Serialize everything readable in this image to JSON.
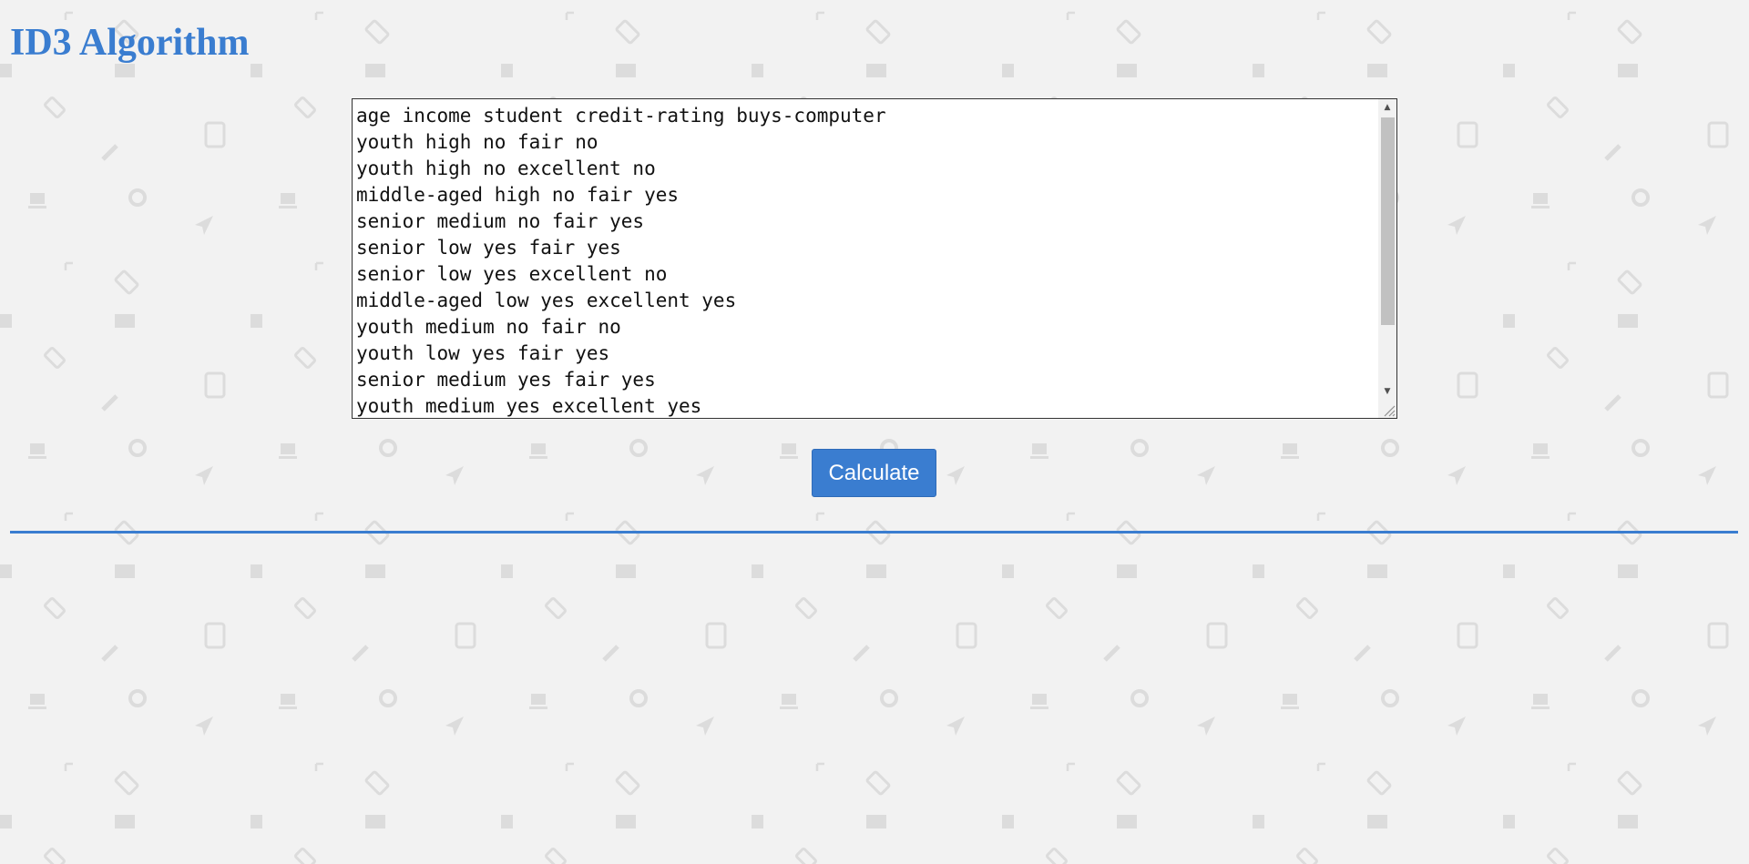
{
  "page": {
    "title": "ID3 Algorithm"
  },
  "dataset": {
    "text": "age income student credit-rating buys-computer\nyouth high no fair no\nyouth high no excellent no\nmiddle-aged high no fair yes\nsenior medium no fair yes\nsenior low yes fair yes\nsenior low yes excellent no\nmiddle-aged low yes excellent yes\nyouth medium no fair no\nyouth low yes fair yes\nsenior medium yes fair yes\nyouth medium yes excellent yes"
  },
  "actions": {
    "calculate_label": "Calculate"
  },
  "icons": {
    "scroll_up": "scroll-up-arrow-icon",
    "scroll_down": "scroll-down-arrow-icon",
    "resize": "resize-grip-icon"
  },
  "colors": {
    "accent": "#3a7dd0",
    "background": "#f2f2f2",
    "pattern": "#dcdcdc"
  }
}
